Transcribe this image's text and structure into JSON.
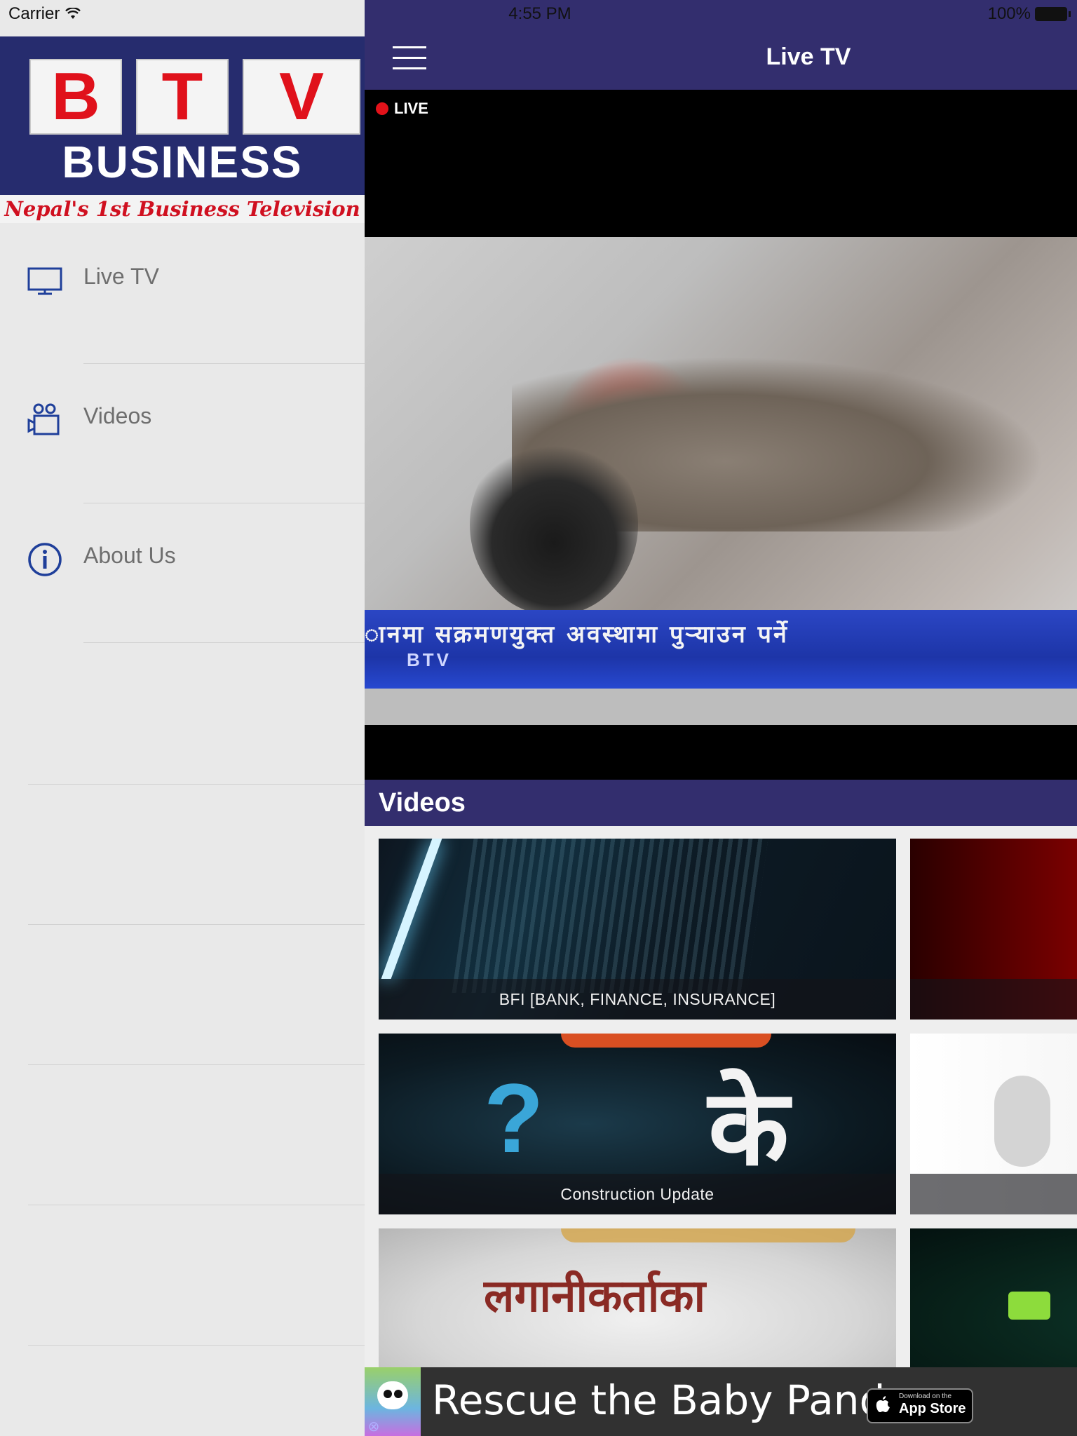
{
  "status_bar": {
    "carrier": "Carrier",
    "time": "4:55 PM",
    "battery": "100%"
  },
  "logo": {
    "letters": [
      "B",
      "T",
      "V"
    ],
    "word": "BUSINESS",
    "tagline": "Nepal's 1st Business Television"
  },
  "sidebar": {
    "items": [
      {
        "label": "Live TV",
        "icon": "tv-icon"
      },
      {
        "label": "Videos",
        "icon": "video-camera-icon"
      },
      {
        "label": "About Us",
        "icon": "info-icon"
      }
    ]
  },
  "header": {
    "title": "Live TV",
    "menu_icon": "hamburger-menu-icon"
  },
  "player": {
    "live_label": "LIVE",
    "ticker_text": "ानमा सक्रमणयुक्त अवस्थामा पुऱ्याउन पर्ने",
    "channel_logo": "BTV"
  },
  "videos_section": {
    "title": "Videos",
    "cards": [
      {
        "caption": "BFI [BANK, FINANCE, INSURANCE]",
        "column": "left",
        "row": 0
      },
      {
        "caption": "",
        "column": "right",
        "row": 0
      },
      {
        "caption": "Construction Update",
        "column": "left",
        "row": 1
      },
      {
        "caption": "",
        "column": "right",
        "row": 1
      },
      {
        "caption": "",
        "column": "left",
        "row": 2
      },
      {
        "caption": "",
        "column": "right",
        "row": 2
      }
    ],
    "thumb_text": {
      "question": "?",
      "ke": "के",
      "invest": "लगानीकर्ताका"
    }
  },
  "ad": {
    "text": "Rescue the Baby Pandas",
    "store_small": "Download on the",
    "store_big": "App Store"
  },
  "colors": {
    "brand_purple": "#332e6e",
    "logo_navy": "#262c6e",
    "logo_red": "#e0111b",
    "live_red": "#e3121a",
    "sidebar_bg": "#e9e9e9",
    "icon_blue": "#1f3f9a"
  }
}
